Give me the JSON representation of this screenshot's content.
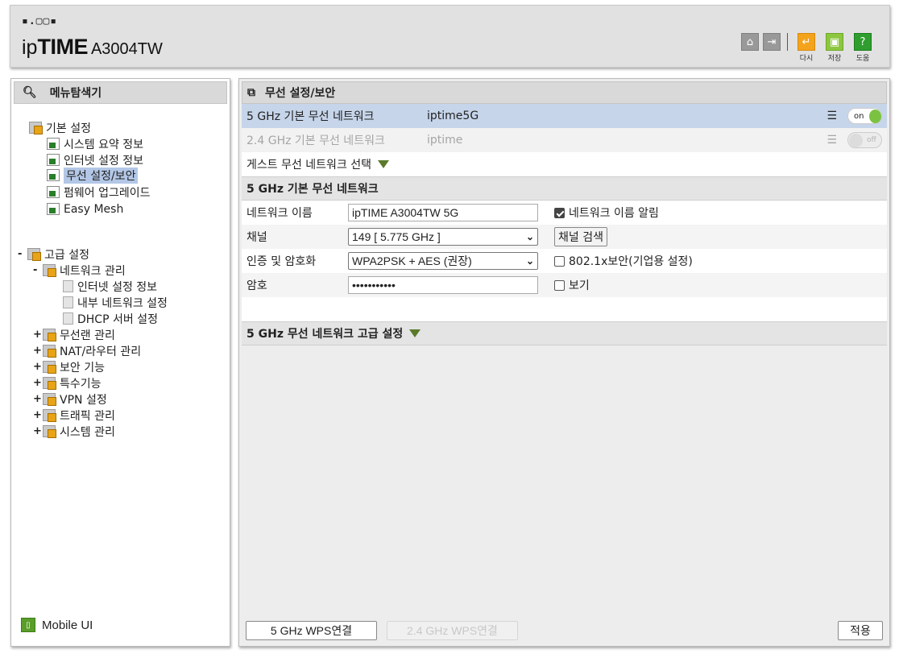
{
  "header": {
    "logo_dots": "▪.▢▢▪",
    "logo_ip": "ip",
    "logo_time": "TIME",
    "model": "A3004TW",
    "icons": {
      "home": "home-icon",
      "logout": "logout-icon"
    },
    "btn_restart": "다시",
    "btn_save": "저장",
    "btn_help": "도움"
  },
  "sidebar": {
    "title": "메뉴탐색기",
    "basic": {
      "label": "기본 설정",
      "items": [
        "시스템 요약 정보",
        "인터넷 설정 정보",
        "무선 설정/보안",
        "펌웨어 업그레이드",
        "Easy Mesh"
      ],
      "selected": "무선 설정/보안"
    },
    "advanced": {
      "toggle": "-",
      "label": "고급 설정",
      "network": {
        "toggle": "-",
        "label": "네트워크 관리",
        "items": [
          "인터넷 설정 정보",
          "내부 네트워크 설정",
          "DHCP 서버 설정"
        ]
      },
      "groups": [
        {
          "toggle": "+",
          "label": "무선랜 관리"
        },
        {
          "toggle": "+",
          "label": "NAT/라우터 관리"
        },
        {
          "toggle": "+",
          "label": "보안 기능"
        },
        {
          "toggle": "+",
          "label": "특수기능"
        },
        {
          "toggle": "+",
          "label": "VPN 설정"
        },
        {
          "toggle": "+",
          "label": "트래픽 관리"
        },
        {
          "toggle": "+",
          "label": "시스템 관리"
        }
      ]
    },
    "mobile": "Mobile UI"
  },
  "main": {
    "title": "무선 설정/보안",
    "networks": [
      {
        "label": "5 GHz 기본 무선 네트워크",
        "ssid": "iptime5G",
        "toggle": "on"
      },
      {
        "label": "2.4 GHz 기본 무선 네트워크",
        "ssid": "iptime",
        "toggle": "off"
      }
    ],
    "guest_select": "게스트 무선 네트워크 선택",
    "section_title": "5 GHz 기본 무선 네트워크",
    "fields": {
      "name_label": "네트워크 이름",
      "name_value": "ipTIME A3004TW 5G",
      "broadcast_label": "네트워크 이름 알림",
      "channel_label": "채널",
      "channel_value": "149 [ 5.775 GHz ]",
      "channel_search": "채널 검색",
      "auth_label": "인증 및 암호화",
      "auth_value": "WPA2PSK + AES (권장)",
      "enterprise_label": "802.1x보안(기업용 설정)",
      "password_label": "암호",
      "password_value": "•••••••••••",
      "show_label": "보기"
    },
    "advanced_title": "5 GHz 무선 네트워크 고급 설정",
    "buttons": {
      "wps5": "5 GHz WPS연결",
      "wps24": "2.4 GHz WPS연결",
      "apply": "적용"
    }
  }
}
